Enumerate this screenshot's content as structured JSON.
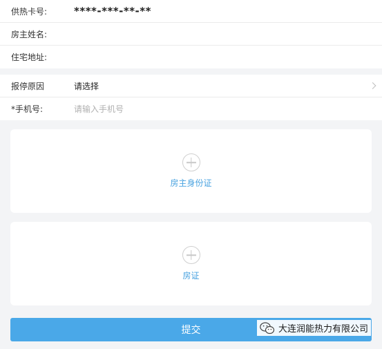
{
  "form": {
    "card_number": {
      "label": "供热卡号:",
      "value": "****-***-**-**"
    },
    "owner_name": {
      "label": "房主姓名:",
      "value": ""
    },
    "address": {
      "label": "住宅地址:",
      "value": ""
    },
    "reason": {
      "label": "报停原因",
      "value": "请选择"
    },
    "phone": {
      "label": "*手机号:",
      "placeholder": "请输入手机号"
    }
  },
  "uploads": [
    {
      "label": "房主身份证",
      "icon": "plus-circle-icon"
    },
    {
      "label": "房证",
      "icon": "plus-circle-icon"
    }
  ],
  "submit": {
    "label": "提交"
  },
  "watermark": {
    "text": "大连润能热力有限公司",
    "icon": "wechat-icon"
  },
  "colors": {
    "accent": "#4aa8e8",
    "upload_label": "#4aa3e0",
    "background": "#f3f4f6"
  }
}
